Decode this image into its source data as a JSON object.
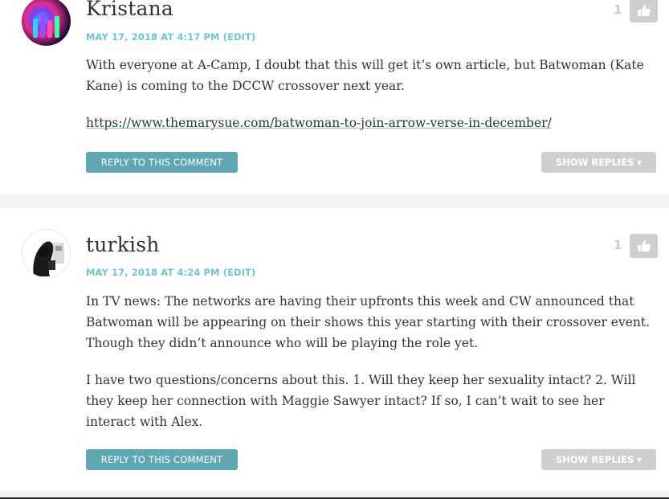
{
  "comments": [
    {
      "author": "Kristana",
      "date": "MAY 17, 2018 AT 4:17 PM",
      "edit_label": "(EDIT)",
      "votes": "1",
      "paragraphs": [
        "With everyone at A-Camp, I doubt that this will get it’s own article, but Batwoman (Kate Kane) is coming to the DCCW crossover next year."
      ],
      "link": "https://www.themarysue.com/batwoman-to-join-arrow-verse-in-december/",
      "reply_label": "REPLY TO THIS COMMENT",
      "show_replies_label": "SHOW REPLIES ▾"
    },
    {
      "author": "turkish",
      "date": "MAY 17, 2018 AT 4:24 PM",
      "edit_label": "(EDIT)",
      "votes": "1",
      "paragraphs": [
        "In TV news: The networks are having their upfronts this week and CW announced that Batwoman will be appearing on their shows this year starting with their crossover event. Though they didn’t announce who will be playing the role yet.",
        "I have two questions/concerns about this. 1. Will they keep her sexuality intact? 2. Will they keep her connection with Maggie Sawyer intact? If so, I can’t wait to see her interact with Alex."
      ],
      "reply_label": "REPLY TO THIS COMMENT",
      "show_replies_label": "SHOW REPLIES ▾"
    }
  ],
  "icons": {
    "vote": "thumbs-up-icon"
  },
  "colors": {
    "meta": "#6fc4cf",
    "reply_button": "#5fa8b3",
    "show_replies_button": "#cfcfcf",
    "vote_button": "#cfcfcf"
  }
}
